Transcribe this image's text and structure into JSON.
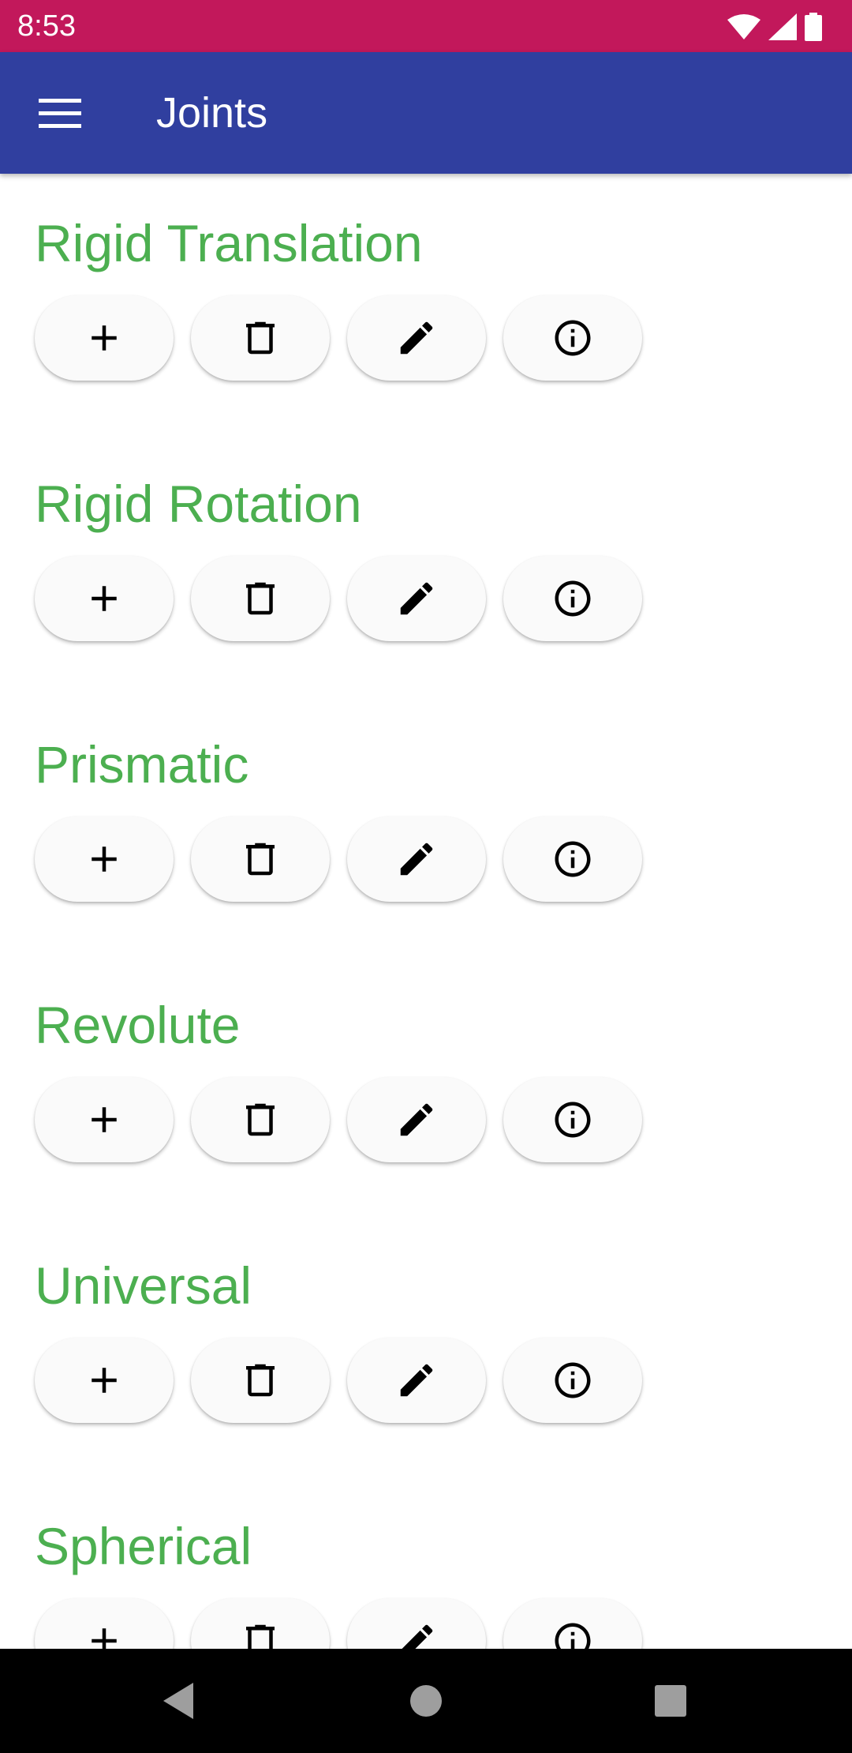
{
  "status_bar": {
    "time": "8:53"
  },
  "app_bar": {
    "title": "Joints"
  },
  "sections": [
    {
      "title": "Rigid Translation"
    },
    {
      "title": "Rigid Rotation"
    },
    {
      "title": "Prismatic"
    },
    {
      "title": "Revolute"
    },
    {
      "title": "Universal"
    },
    {
      "title": "Spherical"
    }
  ],
  "icons": {
    "menu": "hamburger-menu-icon",
    "add": "plus-icon",
    "delete": "trash-icon",
    "edit": "pencil-icon",
    "info": "info-icon"
  },
  "colors": {
    "status_bar": "#C2185B",
    "app_bar": "#303F9F",
    "section_title": "#4CAF50"
  }
}
